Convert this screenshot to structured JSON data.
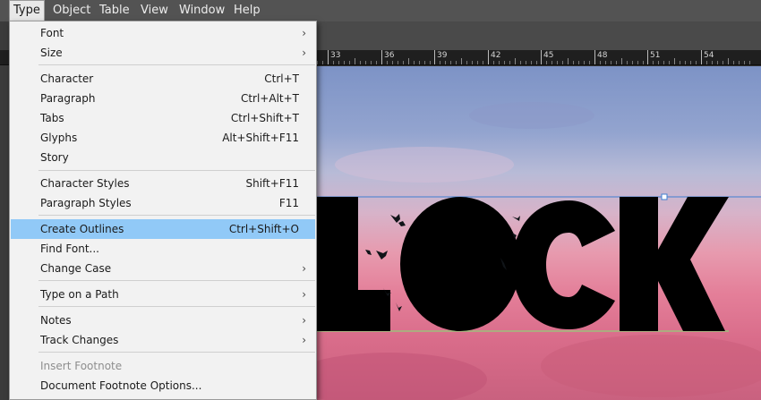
{
  "menubar": {
    "items": [
      {
        "label": "Type",
        "active": true
      },
      {
        "label": "Object"
      },
      {
        "label": "Table"
      },
      {
        "label": "View"
      },
      {
        "label": "Window"
      },
      {
        "label": "Help"
      }
    ]
  },
  "ruler": {
    "labels": [
      "33",
      "36",
      "39",
      "42",
      "45",
      "48",
      "51",
      "54"
    ]
  },
  "type_menu": {
    "groups": [
      [
        {
          "label": "Font",
          "submenu": true
        },
        {
          "label": "Size",
          "submenu": true
        }
      ],
      [
        {
          "label": "Character",
          "shortcut": "Ctrl+T"
        },
        {
          "label": "Paragraph",
          "shortcut": "Ctrl+Alt+T"
        },
        {
          "label": "Tabs",
          "shortcut": "Ctrl+Shift+T"
        },
        {
          "label": "Glyphs",
          "shortcut": "Alt+Shift+F11"
        },
        {
          "label": "Story"
        }
      ],
      [
        {
          "label": "Character Styles",
          "shortcut": "Shift+F11"
        },
        {
          "label": "Paragraph Styles",
          "shortcut": "F11"
        }
      ],
      [
        {
          "label": "Create Outlines",
          "shortcut": "Ctrl+Shift+O",
          "highlighted": true
        },
        {
          "label": "Find Font..."
        },
        {
          "label": "Change Case",
          "submenu": true
        }
      ],
      [
        {
          "label": "Type on a Path",
          "submenu": true
        }
      ],
      [
        {
          "label": "Notes",
          "submenu": true
        },
        {
          "label": "Track Changes",
          "submenu": true
        }
      ],
      [
        {
          "label": "Insert Footnote",
          "disabled": true
        },
        {
          "label": "Document Footnote Options..."
        }
      ]
    ],
    "submenu_arrow": "›"
  },
  "canvas": {
    "text": "LOCK",
    "text_color": "#000000",
    "selection_color": "#3f7fd1"
  }
}
